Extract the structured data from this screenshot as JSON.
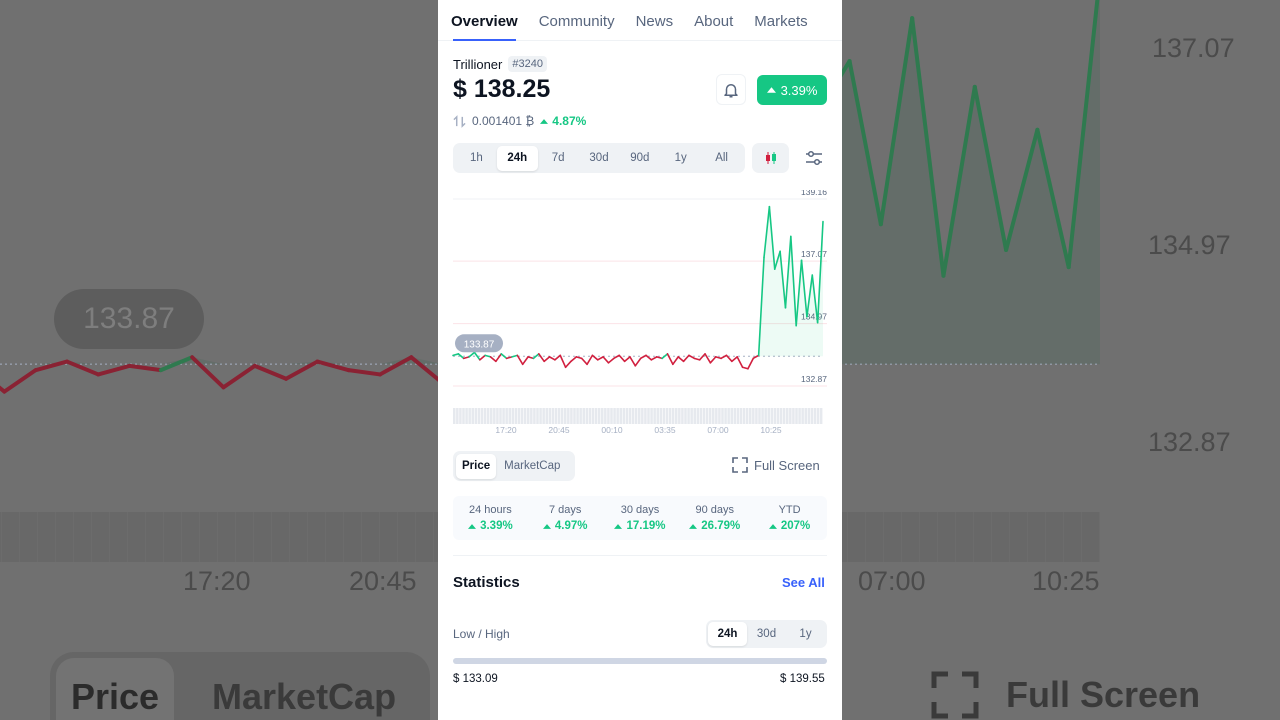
{
  "tabs": [
    {
      "label": "Overview",
      "active": true
    },
    {
      "label": "Community",
      "active": false
    },
    {
      "label": "News",
      "active": false
    },
    {
      "label": "About",
      "active": false
    },
    {
      "label": "Markets",
      "active": false
    }
  ],
  "coin": {
    "name": "Trillioner",
    "rank": "#3240",
    "price": "$ 138.25",
    "change_24h": "3.39%",
    "btc_price": "0.001401 ₿",
    "btc_change": "4.87%"
  },
  "ranges": [
    {
      "label": "1h",
      "active": false
    },
    {
      "label": "24h",
      "active": true
    },
    {
      "label": "7d",
      "active": false
    },
    {
      "label": "30d",
      "active": false
    },
    {
      "label": "90d",
      "active": false
    },
    {
      "label": "1y",
      "active": false
    },
    {
      "label": "All",
      "active": false
    }
  ],
  "chart_data": {
    "type": "line",
    "baseline_label": "133.87",
    "baseline": 133.87,
    "y_ticks": [
      "139.16",
      "137.07",
      "134.97",
      "132.87"
    ],
    "ylim": [
      132.87,
      139.16
    ],
    "x_ticks": [
      "17:20",
      "20:45",
      "00:10",
      "03:35",
      "07:00",
      "10:25"
    ],
    "series": [
      {
        "values": [
          133.9,
          133.95,
          133.8,
          133.85,
          134.0,
          133.75,
          133.9,
          133.85,
          133.7,
          133.95,
          133.8,
          133.85,
          133.9,
          133.6,
          133.85,
          133.8,
          133.95,
          133.7,
          133.85,
          133.75,
          133.9,
          133.5,
          133.7,
          133.85,
          133.8,
          133.6,
          133.9,
          133.75,
          133.85,
          133.65,
          133.8,
          133.9,
          133.7,
          133.85,
          133.55,
          133.8,
          133.9,
          133.75,
          133.85,
          133.8,
          133.95,
          133.6,
          133.85,
          133.7,
          133.9,
          133.8,
          133.75,
          133.95,
          133.65,
          133.85,
          133.8,
          133.9,
          133.7,
          133.85,
          133.5,
          133.45,
          133.8,
          133.9,
          137.2,
          138.9,
          136.8,
          137.4,
          135.5,
          137.9,
          134.9,
          137.1,
          135.2,
          136.6,
          135.0,
          138.4
        ]
      }
    ]
  },
  "toggle": {
    "price": "Price",
    "marketcap": "MarketCap"
  },
  "full_screen": "Full Screen",
  "performance": [
    {
      "label": "24 hours",
      "value": "3.39%"
    },
    {
      "label": "7 days",
      "value": "4.97%"
    },
    {
      "label": "30 days",
      "value": "17.19%"
    },
    {
      "label": "90 days",
      "value": "26.79%"
    },
    {
      "label": "YTD",
      "value": "207%"
    }
  ],
  "statistics": {
    "title": "Statistics",
    "see_all": "See All",
    "low_high_label": "Low / High",
    "periods": [
      {
        "label": "24h",
        "active": true
      },
      {
        "label": "30d",
        "active": false
      },
      {
        "label": "1y",
        "active": false
      }
    ],
    "low": "$ 133.09",
    "high": "$ 139.55"
  },
  "background": {
    "pill": "133.87",
    "y_labels": [
      "137.07",
      "134.97",
      "132.87"
    ],
    "x_labels": [
      "17:20",
      "20:45",
      "07:00",
      "10:25"
    ],
    "price_tab": "Price",
    "marketcap_tab": "MarketCap",
    "full_screen": "Full Screen"
  },
  "colors": {
    "green": "#16c784",
    "red": "#d1203f",
    "accent": "#3861fb"
  }
}
